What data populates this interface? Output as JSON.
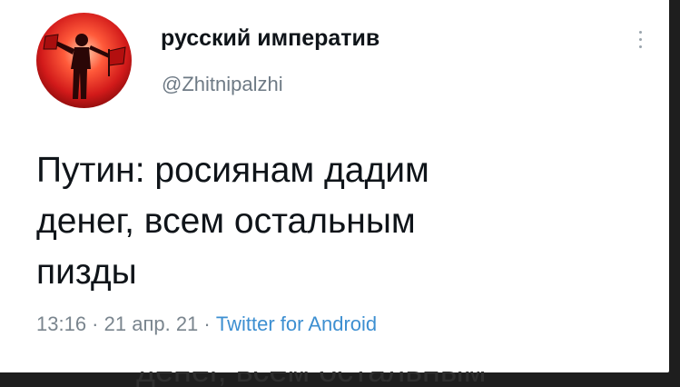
{
  "tweet": {
    "display_name": "русский императив",
    "handle": "@Zhitnipalzhi",
    "text": "Путин: росиянам дадим\nденег, всем остальным\nпизды",
    "time": "13:16",
    "date": "21 апр. 21",
    "source": "Twitter for Android",
    "separator": " · "
  },
  "icons": {
    "avatar": "profile-photo-red-figure",
    "more": "vertical-ellipsis-icon"
  },
  "colors": {
    "background": "#1e1e1e",
    "card": "#ffffff",
    "name": "#0f1419",
    "handle": "#6e7a85",
    "meta": "#7a858e",
    "source_link": "#3d8fd1",
    "avatar_red": "#d81e1e"
  },
  "ghost_text": "денег, всем остальным"
}
